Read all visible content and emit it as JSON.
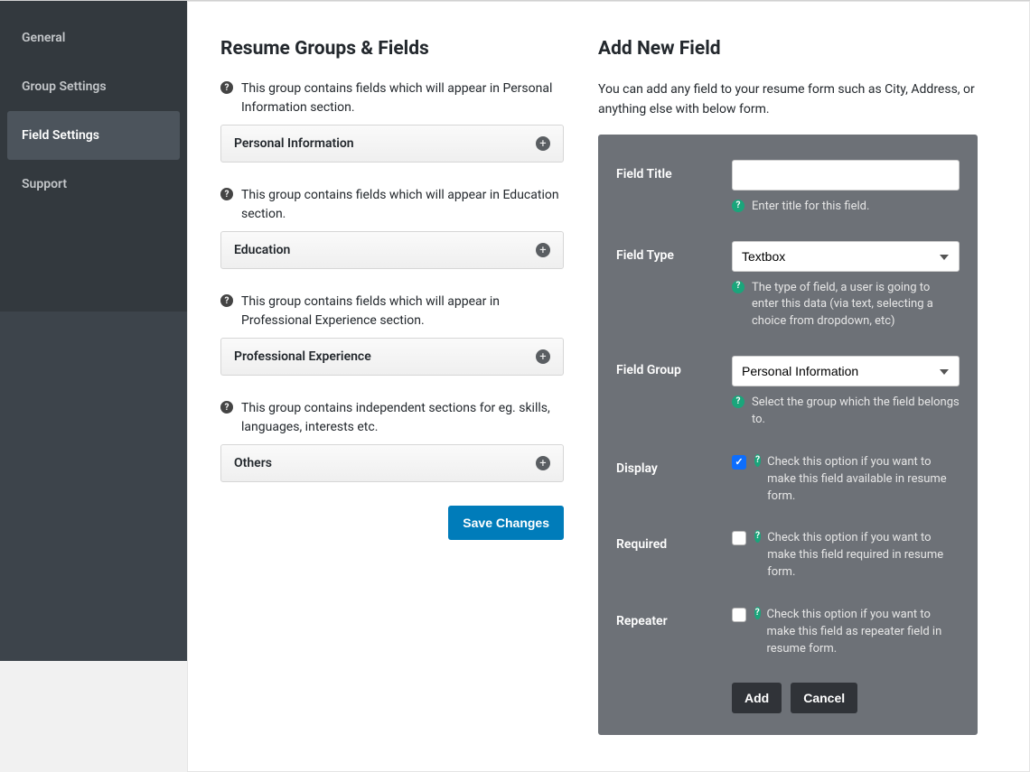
{
  "sidebar": {
    "items": [
      {
        "label": "General"
      },
      {
        "label": "Group Settings"
      },
      {
        "label": "Field Settings"
      },
      {
        "label": "Support"
      }
    ],
    "active_index": 2
  },
  "left": {
    "heading": "Resume Groups & Fields",
    "groups": [
      {
        "description": "This group contains fields which will appear in Personal Information section.",
        "title": "Personal Information"
      },
      {
        "description": "This group contains fields which will appear in Education section.",
        "title": "Education"
      },
      {
        "description": "This group contains fields which will appear in Professional Experience section.",
        "title": "Professional Experience"
      },
      {
        "description": "This group contains independent sections for eg. skills, languages, interests etc.",
        "title": "Others"
      }
    ],
    "save_button": "Save Changes"
  },
  "right": {
    "heading": "Add New Field",
    "intro": "You can add any field to your resume form such as City, Address, or anything else with below form.",
    "labels": {
      "field_title": "Field Title",
      "field_type": "Field Type",
      "field_group": "Field Group",
      "display": "Display",
      "required": "Required",
      "repeater": "Repeater"
    },
    "field_title_value": "",
    "field_title_help": "Enter title for this field.",
    "field_type_selected": "Textbox",
    "field_type_help": "The type of field, a user is going to enter this data (via text, selecting a choice from dropdown, etc)",
    "field_group_selected": "Personal Information",
    "field_group_help": "Select the group which the field belongs to.",
    "display_checked": true,
    "display_help": "Check this option if you want to make this field available in resume form.",
    "required_checked": false,
    "required_help": "Check this option if you want to make this field required in resume form.",
    "repeater_checked": false,
    "repeater_help": "Check this option if you want to make this field as repeater field in resume form.",
    "add_button": "Add",
    "cancel_button": "Cancel"
  }
}
